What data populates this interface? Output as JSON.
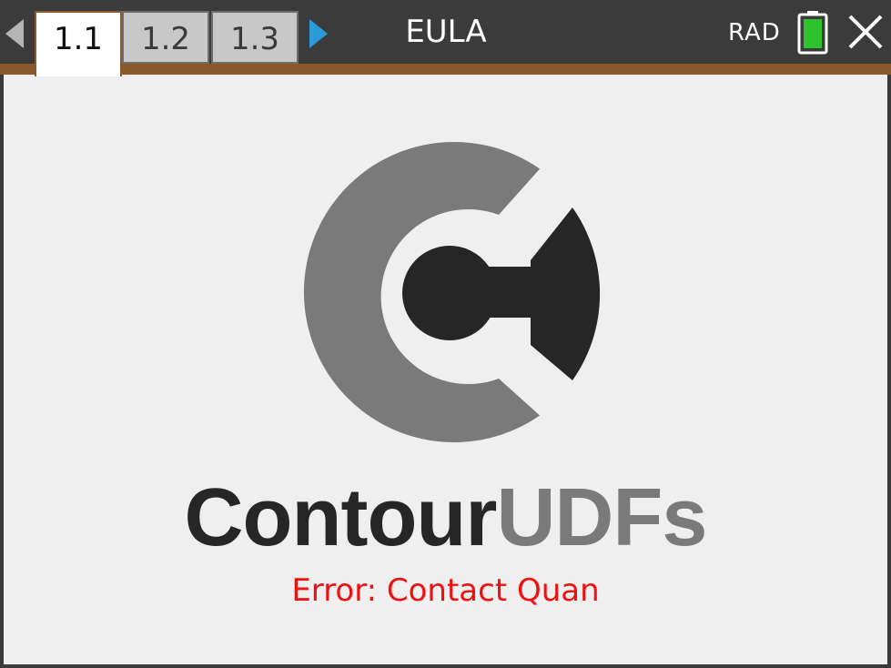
{
  "header": {
    "tabs": [
      {
        "label": "1.1",
        "active": true
      },
      {
        "label": "1.2",
        "active": false
      },
      {
        "label": "1.3",
        "active": false
      }
    ],
    "title": "EULA",
    "angle_mode": "RAD",
    "battery_icon": "battery-full-icon",
    "close_icon": "close-icon",
    "nav_left_icon": "arrow-left-icon",
    "nav_right_icon": "arrow-right-icon"
  },
  "main": {
    "logo": {
      "wordmark_dark": "Contour",
      "wordmark_light": "UDFs"
    },
    "error_text": "Error: Contact Quan"
  },
  "colors": {
    "topbar_bg": "#3b3b3b",
    "accent": "#8a5a2b",
    "nav_arrow_active": "#2a9bd6",
    "battery_fill": "#2ec22e",
    "logo_dark": "#262626",
    "logo_gray": "#7a7a7a",
    "error": "#ee1111",
    "content_bg": "#efefef"
  }
}
